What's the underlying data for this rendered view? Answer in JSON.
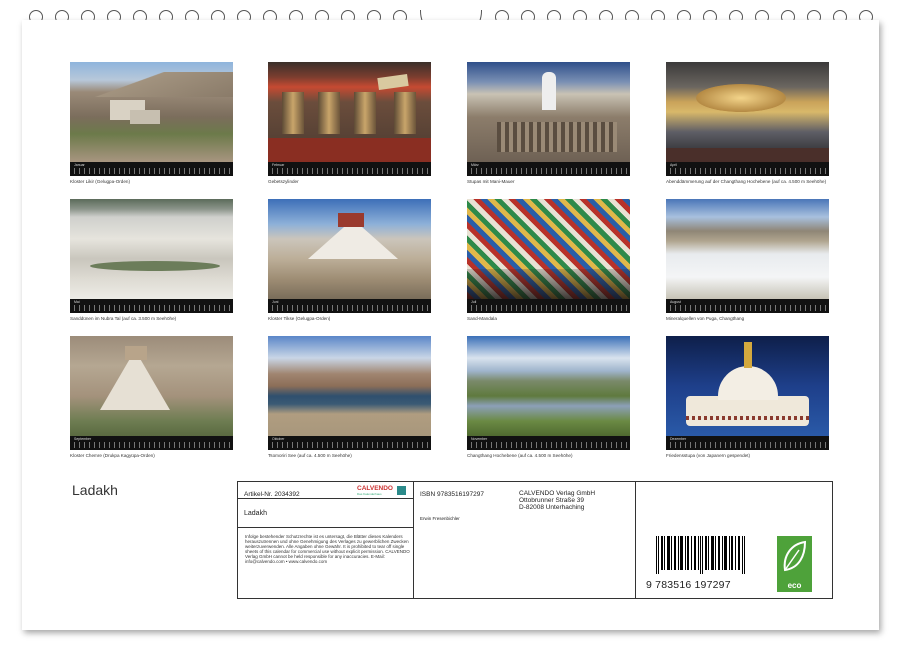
{
  "calendar": {
    "title": "Ladakh",
    "months": [
      {
        "month": "Januar",
        "caption": "Kloster Likir (Gelugpa-Orden)"
      },
      {
        "month": "Februar",
        "caption": "Gebetszylinder"
      },
      {
        "month": "März",
        "caption": "Stupas mit Mani-Mauer"
      },
      {
        "month": "April",
        "caption": "Abenddämmerung auf der Changthang Hochebene (auf ca. 4.500 m Seehöhe)"
      },
      {
        "month": "Mai",
        "caption": "Sanddünen im Nubra Tal (auf ca. 3.500 m Seehöhe)"
      },
      {
        "month": "Juni",
        "caption": "Kloster Tikse (Gelugpa-Orden)"
      },
      {
        "month": "Juli",
        "caption": "Sand-Mandala"
      },
      {
        "month": "August",
        "caption": "Mineralquellen von Puga, Changthang"
      },
      {
        "month": "September",
        "caption": "Kloster Chemre (Drukpa Kagyüpa-Orden)"
      },
      {
        "month": "Oktober",
        "caption": "Tsomoriri See (auf ca. 4.500 m Seehöhe)"
      },
      {
        "month": "November",
        "caption": "Changthang Hochebene (auf ca. 4.500 m Seehöhe)"
      },
      {
        "month": "Dezember",
        "caption": "Friedensstupa (von Japanern gespendet)"
      }
    ]
  },
  "info": {
    "article": "Artikel-Nr. 2034392",
    "logo": "CALVENDO",
    "logo_sub": "Das Kalenderhaus",
    "product_title": "Ladakh",
    "legal": "Infolge bestehender Schutzrechte ist es untersagt, die Blätter dieses Kalenders herauszutrennen und ohne Genehmigung des Verlages zu gewerblichen Zwecken weiterzuverwenden. Alle Angaben ohne Gewähr. It is prohibited to tear off single sheets of this calendar for commercial use without explicit permission. CALVENDO Verlag GmbH cannot be held responsible for any inaccuracies. E-Mail: info@calvendo.com • www.calvendo.com",
    "isbn": "ISBN 9783516197297",
    "publisher_name": "CALVENDO Verlag GmbH",
    "publisher_street": "Ottobrunner Straße 39",
    "publisher_city": "D-82008 Unterhaching",
    "author": "Erwin Fresenbichler",
    "barcode_number": "9 783516 197297",
    "eco_label": "eco"
  }
}
